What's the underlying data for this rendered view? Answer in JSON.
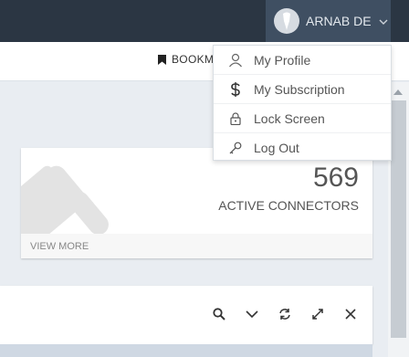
{
  "header": {
    "user_name": "ARNAB DE",
    "icons": {
      "avatar": "user-avatar",
      "chevron": "chevron-down-icon"
    }
  },
  "toolbar": {
    "bookmark_label": "BOOKM",
    "bookmark_icon": "bookmark-icon"
  },
  "user_menu": {
    "items": [
      {
        "label": "My Profile",
        "icon": "user-icon"
      },
      {
        "label": "My Subscription",
        "icon": "dollar-icon"
      },
      {
        "label": "Lock Screen",
        "icon": "lock-icon"
      },
      {
        "label": "Log Out",
        "icon": "key-icon"
      }
    ]
  },
  "stat_card": {
    "value": "569",
    "label": "ACTIVE CONNECTORS",
    "footer": "VIEW MORE",
    "icon": "plug-icon"
  },
  "panel": {
    "tools": [
      "search-icon",
      "chevron-down-icon",
      "refresh-icon",
      "expand-icon",
      "close-icon"
    ]
  }
}
